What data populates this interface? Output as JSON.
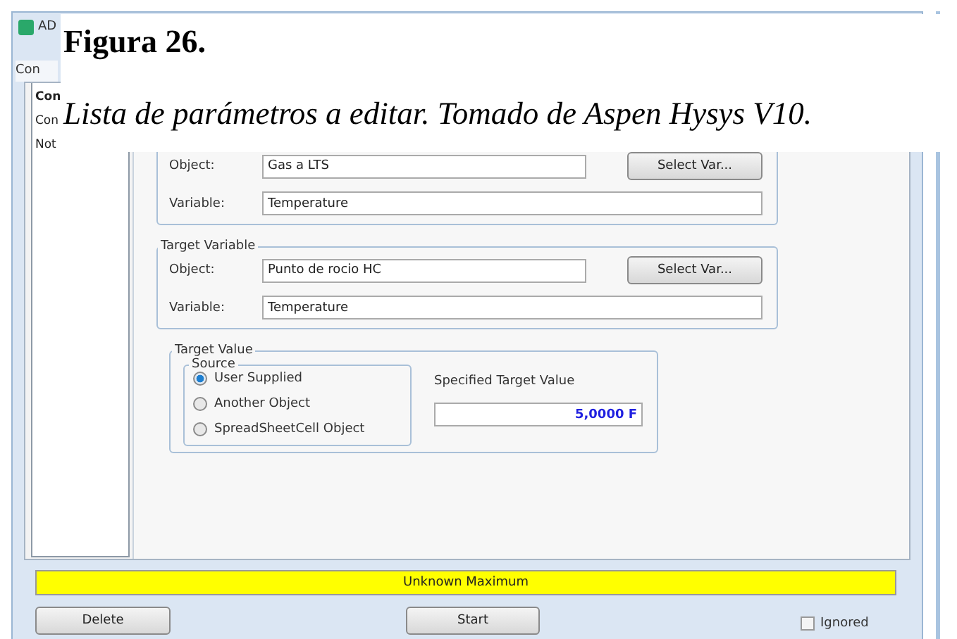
{
  "window": {
    "title": "AD"
  },
  "tabs": [
    {
      "label": "Con",
      "selected": true
    }
  ],
  "sidebar": {
    "items": [
      {
        "label": "Con",
        "selected": true
      },
      {
        "label": "Con",
        "selected": false
      },
      {
        "label": "Not",
        "selected": false
      }
    ]
  },
  "adjusted_variable": {
    "object": "Gas a LTS",
    "variable": "Temperature",
    "object_label": "Object:",
    "variable_label": "Variable:",
    "button": "Select Var..."
  },
  "target_variable": {
    "title": "Target Variable",
    "object": "Punto de rocio HC",
    "variable": "Temperature",
    "object_label": "Object:",
    "variable_label": "Variable:",
    "button": "Select Var..."
  },
  "target_value": {
    "title": "Target Value",
    "source_title": "Source",
    "options": [
      {
        "label": "User Supplied",
        "selected": true
      },
      {
        "label": "Another Object",
        "selected": false
      },
      {
        "label": "SpreadSheetCell Object",
        "selected": false
      }
    ],
    "specified_label": "Specified Target Value",
    "specified_value": "5,0000 F"
  },
  "status_bar": "Unknown Maximum",
  "buttons": {
    "delete": "Delete",
    "start": "Start"
  },
  "ignored": {
    "label": "Ignored",
    "checked": false
  },
  "caption": {
    "figure_label": "Figura 26.",
    "text": "Lista de parámetros a editar. Tomado de Aspen Hysys V10."
  }
}
